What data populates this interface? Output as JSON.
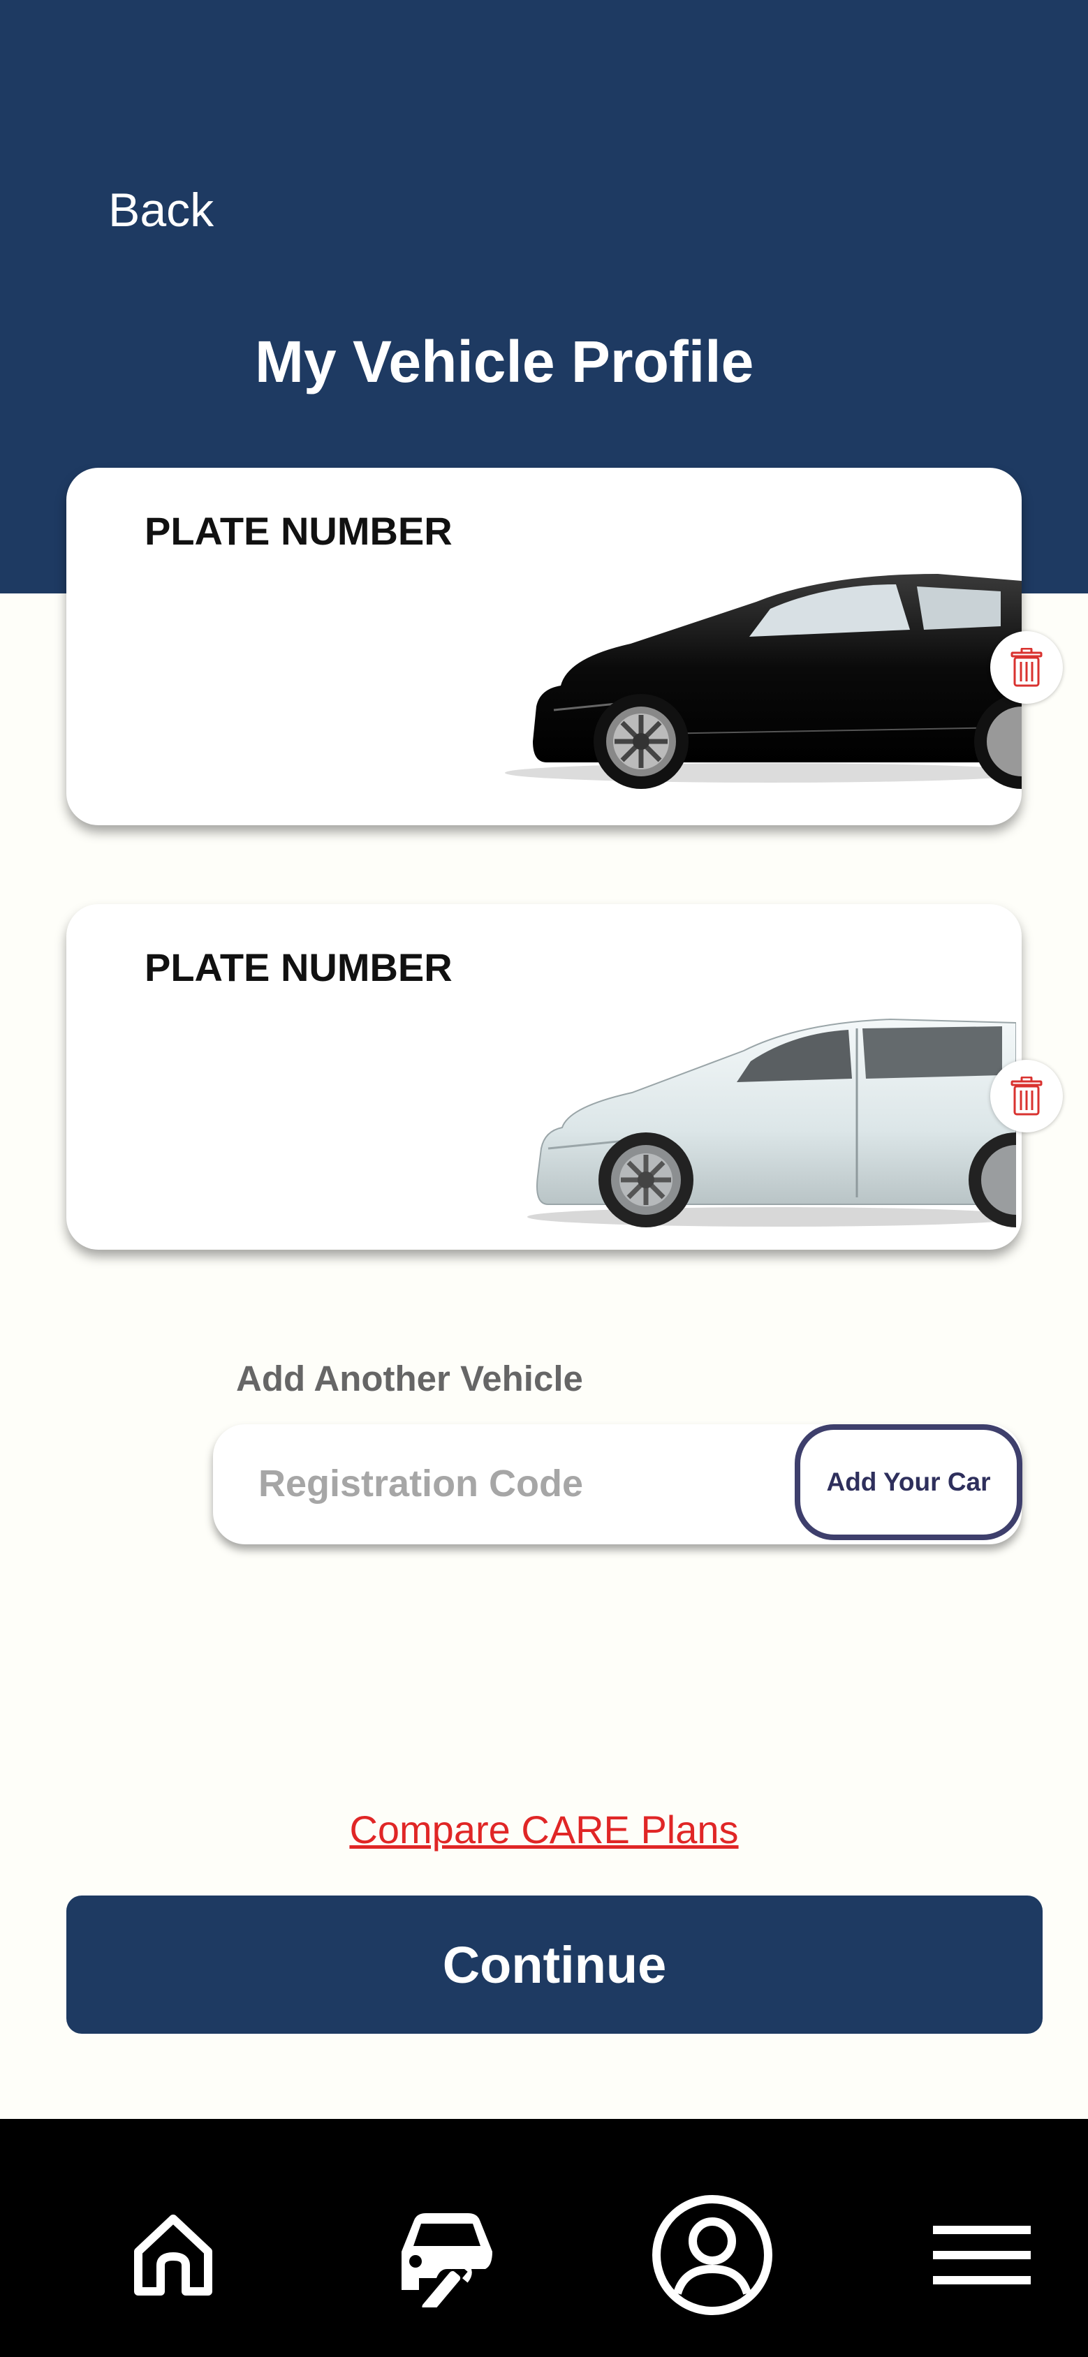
{
  "header": {
    "back_label": "Back",
    "title": "My Vehicle Profile",
    "background_color": "#1e3a62"
  },
  "vehicles": [
    {
      "plate_label": "PLATE NUMBER",
      "car_color": "black",
      "delete_icon": "trash-icon"
    },
    {
      "plate_label": "PLATE NUMBER",
      "car_color": "white",
      "delete_icon": "trash-icon"
    }
  ],
  "add_vehicle": {
    "heading": "Add Another Vehicle",
    "input_placeholder": "Registration Code",
    "input_value": "",
    "button_label": "Add Your Car"
  },
  "links": {
    "compare_plans": "Compare CARE Plans",
    "compare_color": "#e02626"
  },
  "primary_action": {
    "continue_label": "Continue"
  },
  "bottom_nav": {
    "items": [
      {
        "icon": "home-icon"
      },
      {
        "icon": "car-service-icon"
      },
      {
        "icon": "profile-icon"
      },
      {
        "icon": "menu-icon"
      }
    ]
  }
}
